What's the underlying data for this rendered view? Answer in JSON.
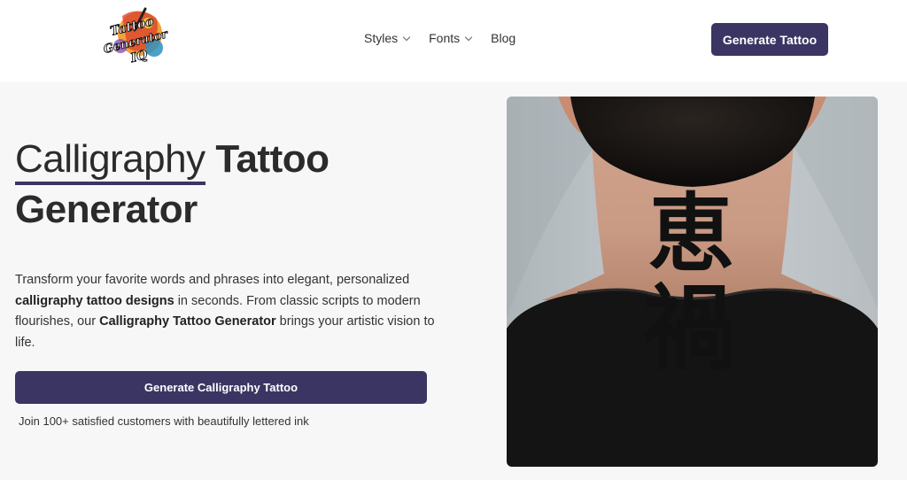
{
  "header": {
    "logo_lines": [
      "Tattoo",
      "Generator",
      "IQ"
    ],
    "nav": [
      {
        "label": "Styles",
        "has_dropdown": true,
        "icon": "chevron-down-icon"
      },
      {
        "label": "Fonts",
        "has_dropdown": true,
        "icon": "chevron-down-icon"
      },
      {
        "label": "Blog",
        "has_dropdown": false
      }
    ],
    "cta_label": "Generate Tattoo"
  },
  "hero": {
    "title_light": "Calligraphy",
    "title_bold_1": "Tattoo",
    "title_bold_2": "Generator",
    "description": {
      "p1": "Transform your favorite words and phrases into elegant, personalized ",
      "b1": "calligraphy tattoo designs",
      "p2": " in seconds. From classic scripts to modern flourishes, our ",
      "b2": "Calligraphy Tattoo Generator",
      "p3": " brings your artistic vision to life."
    },
    "cta_label": "Generate Calligraphy Tattoo",
    "social_proof": "Join 100+ satisfied customers with beautifully lettered ink"
  },
  "image": {
    "subject": "neck-tattoo-photo",
    "tattoo_characters": [
      "恵",
      "禍"
    ]
  },
  "colors": {
    "accent": "#3b3564",
    "background": "#f7f7f7",
    "header_background": "#ffffff",
    "text": "#2b2b2b"
  }
}
